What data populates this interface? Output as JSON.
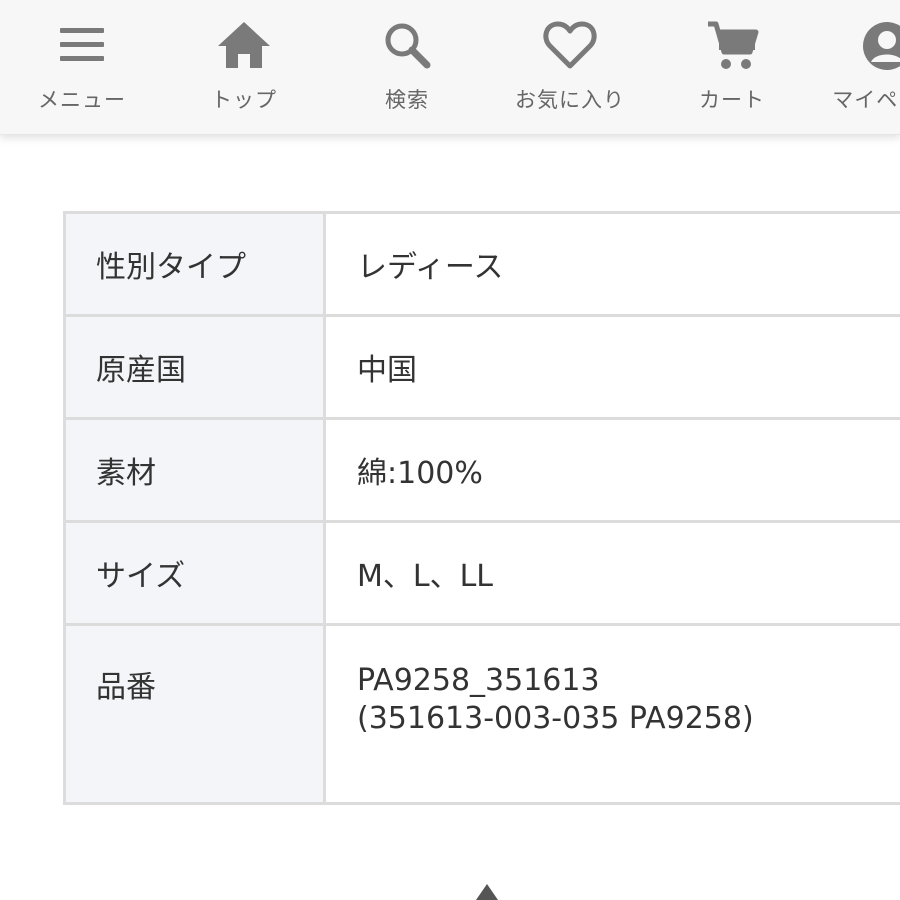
{
  "nav": {
    "items": [
      {
        "label": "メニュー",
        "icon": "menu-icon"
      },
      {
        "label": "トップ",
        "icon": "home-icon"
      },
      {
        "label": "検索",
        "icon": "search-icon"
      },
      {
        "label": "お気に入り",
        "icon": "heart-icon"
      },
      {
        "label": "カート",
        "icon": "cart-icon"
      },
      {
        "label": "マイページ",
        "icon": "account-icon"
      }
    ]
  },
  "spec": {
    "rows": [
      {
        "key": "性別タイプ",
        "value": "レディース"
      },
      {
        "key": "原産国",
        "value": "中国"
      },
      {
        "key": "素材",
        "value": "綿:100%"
      },
      {
        "key": "サイズ",
        "value": "M、L、LL"
      },
      {
        "key": "品番",
        "value_lines": [
          "PA9258_351613",
          "(351613-003-035 PA9258)"
        ]
      }
    ]
  },
  "colors": {
    "icon": "#7a7a7a",
    "nav_bg": "#f7f7f7",
    "key_bg": "#f4f5f8",
    "border": "#dcdcdc"
  },
  "scroll_top_icon": "triangle-up-icon"
}
